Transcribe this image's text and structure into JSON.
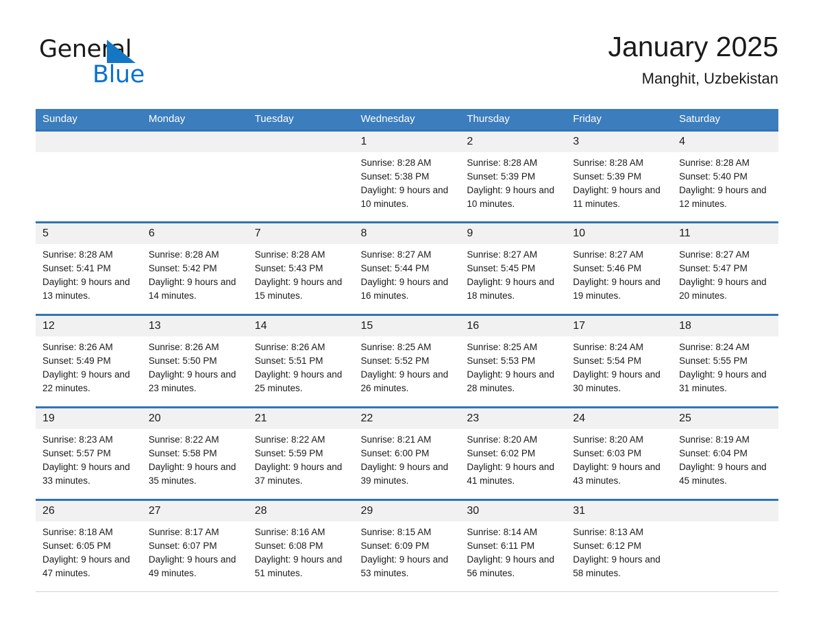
{
  "brand": {
    "name_part1": "General",
    "name_part2": "Blue",
    "triangle_color": "#1577c4",
    "blue_text_color": "#0b72ce"
  },
  "header": {
    "month_title": "January 2025",
    "location": "Manghit, Uzbekistan"
  },
  "theme": {
    "header_row_bg": "#3b7dbd",
    "row_top_border": "#2f74b5",
    "daynum_bg": "#f1f1f1",
    "cell_border": "#d2d2d2"
  },
  "weekday_headers": [
    "Sunday",
    "Monday",
    "Tuesday",
    "Wednesday",
    "Thursday",
    "Friday",
    "Saturday"
  ],
  "labels": {
    "sunrise_prefix": "Sunrise:",
    "sunset_prefix": "Sunset:",
    "daylight_prefix": "Daylight:"
  },
  "weeks": [
    [
      {
        "day": "",
        "empty": true
      },
      {
        "day": "",
        "empty": true
      },
      {
        "day": "",
        "empty": true
      },
      {
        "day": "1",
        "sunrise": "Sunrise: 8:28 AM",
        "sunset": "Sunset: 5:38 PM",
        "daylight": "Daylight: 9 hours and 10 minutes."
      },
      {
        "day": "2",
        "sunrise": "Sunrise: 8:28 AM",
        "sunset": "Sunset: 5:39 PM",
        "daylight": "Daylight: 9 hours and 10 minutes."
      },
      {
        "day": "3",
        "sunrise": "Sunrise: 8:28 AM",
        "sunset": "Sunset: 5:39 PM",
        "daylight": "Daylight: 9 hours and 11 minutes."
      },
      {
        "day": "4",
        "sunrise": "Sunrise: 8:28 AM",
        "sunset": "Sunset: 5:40 PM",
        "daylight": "Daylight: 9 hours and 12 minutes."
      }
    ],
    [
      {
        "day": "5",
        "sunrise": "Sunrise: 8:28 AM",
        "sunset": "Sunset: 5:41 PM",
        "daylight": "Daylight: 9 hours and 13 minutes."
      },
      {
        "day": "6",
        "sunrise": "Sunrise: 8:28 AM",
        "sunset": "Sunset: 5:42 PM",
        "daylight": "Daylight: 9 hours and 14 minutes."
      },
      {
        "day": "7",
        "sunrise": "Sunrise: 8:28 AM",
        "sunset": "Sunset: 5:43 PM",
        "daylight": "Daylight: 9 hours and 15 minutes."
      },
      {
        "day": "8",
        "sunrise": "Sunrise: 8:27 AM",
        "sunset": "Sunset: 5:44 PM",
        "daylight": "Daylight: 9 hours and 16 minutes."
      },
      {
        "day": "9",
        "sunrise": "Sunrise: 8:27 AM",
        "sunset": "Sunset: 5:45 PM",
        "daylight": "Daylight: 9 hours and 18 minutes."
      },
      {
        "day": "10",
        "sunrise": "Sunrise: 8:27 AM",
        "sunset": "Sunset: 5:46 PM",
        "daylight": "Daylight: 9 hours and 19 minutes."
      },
      {
        "day": "11",
        "sunrise": "Sunrise: 8:27 AM",
        "sunset": "Sunset: 5:47 PM",
        "daylight": "Daylight: 9 hours and 20 minutes."
      }
    ],
    [
      {
        "day": "12",
        "sunrise": "Sunrise: 8:26 AM",
        "sunset": "Sunset: 5:49 PM",
        "daylight": "Daylight: 9 hours and 22 minutes."
      },
      {
        "day": "13",
        "sunrise": "Sunrise: 8:26 AM",
        "sunset": "Sunset: 5:50 PM",
        "daylight": "Daylight: 9 hours and 23 minutes."
      },
      {
        "day": "14",
        "sunrise": "Sunrise: 8:26 AM",
        "sunset": "Sunset: 5:51 PM",
        "daylight": "Daylight: 9 hours and 25 minutes."
      },
      {
        "day": "15",
        "sunrise": "Sunrise: 8:25 AM",
        "sunset": "Sunset: 5:52 PM",
        "daylight": "Daylight: 9 hours and 26 minutes."
      },
      {
        "day": "16",
        "sunrise": "Sunrise: 8:25 AM",
        "sunset": "Sunset: 5:53 PM",
        "daylight": "Daylight: 9 hours and 28 minutes."
      },
      {
        "day": "17",
        "sunrise": "Sunrise: 8:24 AM",
        "sunset": "Sunset: 5:54 PM",
        "daylight": "Daylight: 9 hours and 30 minutes."
      },
      {
        "day": "18",
        "sunrise": "Sunrise: 8:24 AM",
        "sunset": "Sunset: 5:55 PM",
        "daylight": "Daylight: 9 hours and 31 minutes."
      }
    ],
    [
      {
        "day": "19",
        "sunrise": "Sunrise: 8:23 AM",
        "sunset": "Sunset: 5:57 PM",
        "daylight": "Daylight: 9 hours and 33 minutes."
      },
      {
        "day": "20",
        "sunrise": "Sunrise: 8:22 AM",
        "sunset": "Sunset: 5:58 PM",
        "daylight": "Daylight: 9 hours and 35 minutes."
      },
      {
        "day": "21",
        "sunrise": "Sunrise: 8:22 AM",
        "sunset": "Sunset: 5:59 PM",
        "daylight": "Daylight: 9 hours and 37 minutes."
      },
      {
        "day": "22",
        "sunrise": "Sunrise: 8:21 AM",
        "sunset": "Sunset: 6:00 PM",
        "daylight": "Daylight: 9 hours and 39 minutes."
      },
      {
        "day": "23",
        "sunrise": "Sunrise: 8:20 AM",
        "sunset": "Sunset: 6:02 PM",
        "daylight": "Daylight: 9 hours and 41 minutes."
      },
      {
        "day": "24",
        "sunrise": "Sunrise: 8:20 AM",
        "sunset": "Sunset: 6:03 PM",
        "daylight": "Daylight: 9 hours and 43 minutes."
      },
      {
        "day": "25",
        "sunrise": "Sunrise: 8:19 AM",
        "sunset": "Sunset: 6:04 PM",
        "daylight": "Daylight: 9 hours and 45 minutes."
      }
    ],
    [
      {
        "day": "26",
        "sunrise": "Sunrise: 8:18 AM",
        "sunset": "Sunset: 6:05 PM",
        "daylight": "Daylight: 9 hours and 47 minutes."
      },
      {
        "day": "27",
        "sunrise": "Sunrise: 8:17 AM",
        "sunset": "Sunset: 6:07 PM",
        "daylight": "Daylight: 9 hours and 49 minutes."
      },
      {
        "day": "28",
        "sunrise": "Sunrise: 8:16 AM",
        "sunset": "Sunset: 6:08 PM",
        "daylight": "Daylight: 9 hours and 51 minutes."
      },
      {
        "day": "29",
        "sunrise": "Sunrise: 8:15 AM",
        "sunset": "Sunset: 6:09 PM",
        "daylight": "Daylight: 9 hours and 53 minutes."
      },
      {
        "day": "30",
        "sunrise": "Sunrise: 8:14 AM",
        "sunset": "Sunset: 6:11 PM",
        "daylight": "Daylight: 9 hours and 56 minutes."
      },
      {
        "day": "31",
        "sunrise": "Sunrise: 8:13 AM",
        "sunset": "Sunset: 6:12 PM",
        "daylight": "Daylight: 9 hours and 58 minutes."
      },
      {
        "day": "",
        "empty": true
      }
    ]
  ]
}
